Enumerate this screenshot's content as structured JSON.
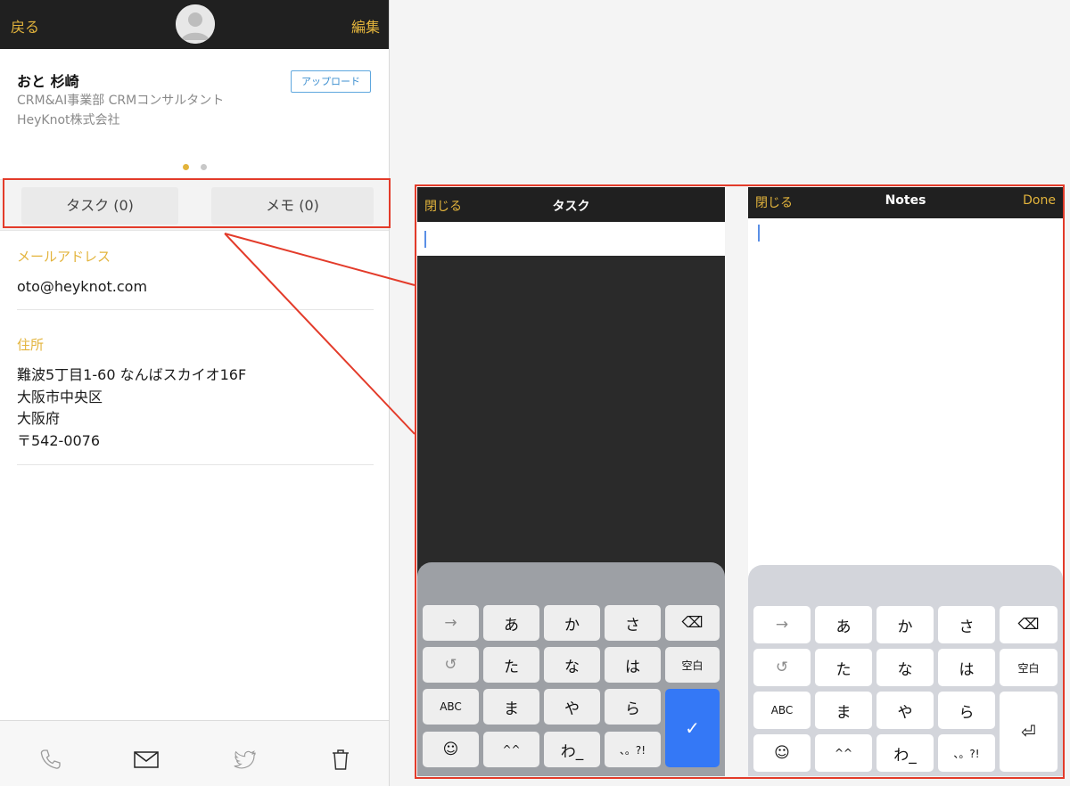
{
  "colors": {
    "accent": "#e3b43c",
    "frame": "#e33b2a",
    "confirm": "#3478f6"
  },
  "contact": {
    "nav": {
      "back_label": "戻る",
      "edit_label": "編集"
    },
    "name": "おと 杉崎",
    "department": "CRM&AI事業部 CRMコンサルタント",
    "company": "HeyKnot株式会社",
    "upload_label": "アップロード",
    "tabs": {
      "task_label": "タスク (0)",
      "memo_label": "メモ (0)"
    },
    "email": {
      "label": "メールアドレス",
      "value": "oto@heyknot.com"
    },
    "address": {
      "label": "住所",
      "lines": [
        "難波5丁目1-60 なんばスカイオ16F",
        "大阪市中央区",
        "大阪府",
        "〒542-0076"
      ]
    },
    "bottom_icons": [
      "phone-icon",
      "mail-icon",
      "twitter-icon",
      "trash-icon"
    ]
  },
  "task_screen": {
    "close_label": "閉じる",
    "title": "タスク"
  },
  "notes_screen": {
    "close_label": "閉じる",
    "title": "Notes",
    "done_label": "Done"
  },
  "keyboard": {
    "row1": [
      "→",
      "あ",
      "か",
      "さ",
      "⌫"
    ],
    "row2": [
      "↺",
      "た",
      "な",
      "は",
      "空白"
    ],
    "row3": [
      "ABC",
      "ま",
      "や",
      "ら"
    ],
    "row4": [
      "☺",
      "^^",
      "わ_",
      "、。?!"
    ],
    "confirm_key": "✓",
    "return_key": "⏎"
  }
}
